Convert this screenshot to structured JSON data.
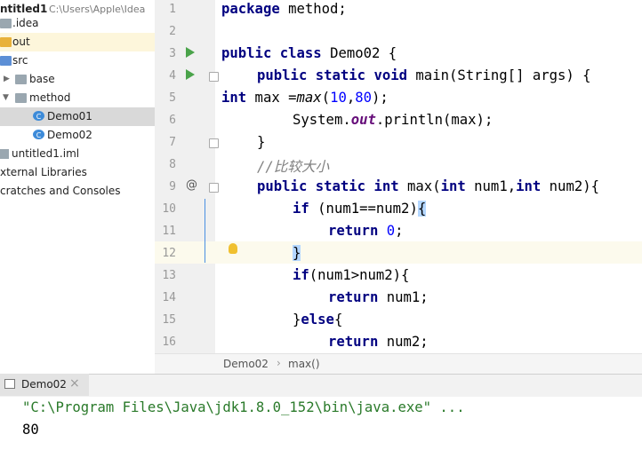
{
  "project_tree": {
    "root_name": "ntitled1",
    "root_path": "C:\\Users\\Apple\\Idea",
    "items": [
      {
        "label": ".idea"
      },
      {
        "label": "out"
      },
      {
        "label": "src"
      },
      {
        "label": "base"
      },
      {
        "label": "method"
      },
      {
        "label": "Demo01"
      },
      {
        "label": "Demo02"
      },
      {
        "label": "untitled1.iml"
      },
      {
        "label": "xternal Libraries"
      },
      {
        "label": "cratches and Consoles"
      }
    ]
  },
  "editor": {
    "line_numbers": [
      "1",
      "2",
      "3",
      "4",
      "5",
      "6",
      "7",
      "8",
      "9",
      "10",
      "11",
      "12",
      "13",
      "14",
      "15",
      "16"
    ],
    "code": {
      "l1_kw": "package",
      "l1_rest": " method;",
      "l3_kw1": "public",
      "l3_kw2": "class",
      "l3_rest": " Demo02 {",
      "l4_kw1": "public",
      "l4_kw2": "static",
      "l4_kw3": "void",
      "l4_rest": " main(String[] args) {",
      "l5_kw": "int",
      "l5_a": " max =",
      "l5_fn": "max",
      "l5_b": "(",
      "l5_n1": "10",
      "l5_c": ",",
      "l5_n2": "80",
      "l5_d": ");",
      "l6_a": "System.",
      "l6_fld": "out",
      "l6_b": ".println(max);",
      "l7": "}",
      "l8_cmt": "//比较大小",
      "l9_kw1": "public",
      "l9_kw2": "static",
      "l9_kw3": "int",
      "l9_a": " max(",
      "l9_kw4": "int",
      "l9_b": " num1,",
      "l9_kw5": "int",
      "l9_c": " num2){",
      "l10_kw": "if",
      "l10_a": " (num1==num2)",
      "l10_brace": "{",
      "l11_kw": "return",
      "l11_n": "0",
      "l11_a": ";",
      "l12_brace": "}",
      "l13_kw": "if",
      "l13_a": "(num1>num2){",
      "l14_kw": "return",
      "l14_a": " num1;",
      "l15_a": "}",
      "l15_kw": "else",
      "l15_b": "{",
      "l16_kw": "return",
      "l16_a": " num2;"
    }
  },
  "breadcrumb": {
    "class": "Demo02",
    "sep": "›",
    "method": "max()"
  },
  "run_panel": {
    "tab_label": "Demo02",
    "close": "×",
    "command": "\"C:\\Program Files\\Java\\jdk1.8.0_152\\bin\\java.exe\" ...",
    "output": "80"
  },
  "colors": {
    "keyword": "#000080",
    "number": "#0000ff",
    "comment": "#808080",
    "field": "#660e7a",
    "command": "#2a7a2a"
  }
}
